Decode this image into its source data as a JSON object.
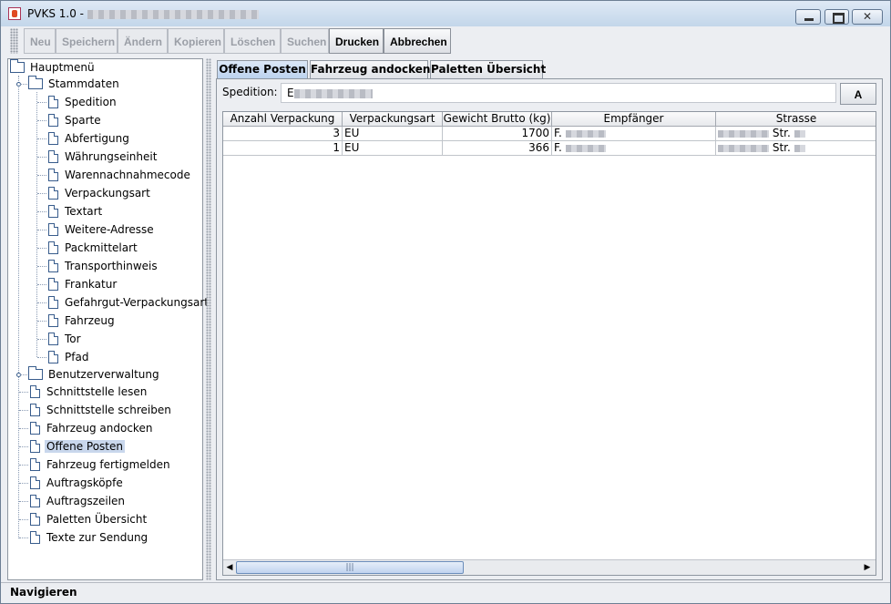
{
  "window": {
    "title": "PVKS 1.0 - "
  },
  "toolbar": {
    "buttons": [
      {
        "label": "Neu",
        "enabled": false
      },
      {
        "label": "Speichern",
        "enabled": false
      },
      {
        "label": "Ändern",
        "enabled": false
      },
      {
        "label": "Kopieren",
        "enabled": false
      },
      {
        "label": "Löschen",
        "enabled": false
      },
      {
        "label": "Suchen",
        "enabled": false
      },
      {
        "label": "Drucken",
        "enabled": true
      },
      {
        "label": "Abbrechen",
        "enabled": true
      }
    ]
  },
  "tree": {
    "root": "Hauptmenü",
    "stammdaten": {
      "label": "Stammdaten",
      "items": [
        "Spedition",
        "Sparte",
        "Abfertigung",
        "Währungseinheit",
        "Warennachnahmecode",
        "Verpackungsart",
        "Textart",
        "Weitere-Adresse",
        "Packmittelart",
        "Transporthinweis",
        "Frankatur",
        "Gefahrgut-Verpackungsart",
        "Fahrzeug",
        "Tor",
        "Pfad"
      ]
    },
    "benutzerverwaltung": "Benutzerverwaltung",
    "items": [
      "Schnittstelle lesen",
      "Schnittstelle schreiben",
      "Fahrzeug andocken",
      "Offene Posten",
      "Fahrzeug fertigmelden",
      "Auftragsköpfe",
      "Auftragszeilen",
      "Paletten Übersicht",
      "Texte zur Sendung"
    ],
    "selected": "Offene Posten"
  },
  "tabs": [
    "Offene Posten",
    "Fahrzeug andocken",
    "Paletten Übersicht"
  ],
  "active_tab": "Offene Posten",
  "spedition": {
    "label": "Spedition:",
    "value": "E",
    "button_label": "A"
  },
  "table": {
    "columns": [
      "Anzahl Verpackung",
      "Verpackungsart",
      "Gewicht Brutto (kg)",
      "Empfänger",
      "Strasse"
    ],
    "rows": [
      {
        "anzahl": "3",
        "art": "EU",
        "gewicht": "1700",
        "empfaenger": "F.",
        "strasse": "Str."
      },
      {
        "anzahl": "1",
        "art": "EU",
        "gewicht": "366",
        "empfaenger": "F.",
        "strasse": "Str."
      }
    ]
  },
  "scrollbar": {
    "left_arrow": "◀",
    "right_arrow": "▶",
    "thumb_grip": "|||"
  },
  "status": {
    "text": "Navigieren"
  },
  "colors": {
    "selection": "#c9d7ec",
    "tab_active": "#bcd2ee",
    "tree_icon": "#385c8c"
  }
}
